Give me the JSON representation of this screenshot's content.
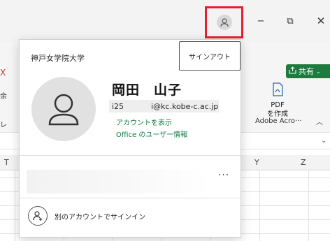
{
  "titlebar": {
    "account_icon": "person-icon",
    "minimize_glyph": "−",
    "restore_glyph": "⧉",
    "close_glyph": "✕",
    "highlight_color": "#e3212d"
  },
  "ribbon": {
    "share_label": "共有",
    "share_icon": "share-icon",
    "pdf_label_line1": "PDF",
    "pdf_label_line2": "を作成",
    "acrobat_group_label": "Adobe Acro···",
    "left_fragments": [
      "X",
      "余",
      "レ"
    ],
    "accent_color": "#1f7a3f"
  },
  "sheet": {
    "columns": [
      "T",
      "Y",
      "Z"
    ]
  },
  "account_popup": {
    "organization": "神戸女学院大学",
    "signout_label": "サインアウト",
    "user_name": "岡田　山子",
    "id_prefix": "i25",
    "email": "i@kc.kobe-c.ac.jp",
    "view_account_link": "アカウントを表示",
    "office_info_link": "Office のユーザー情報",
    "more_label": "···",
    "add_account_label": "別のアカウントでサインイン",
    "link_color": "#107c41"
  }
}
